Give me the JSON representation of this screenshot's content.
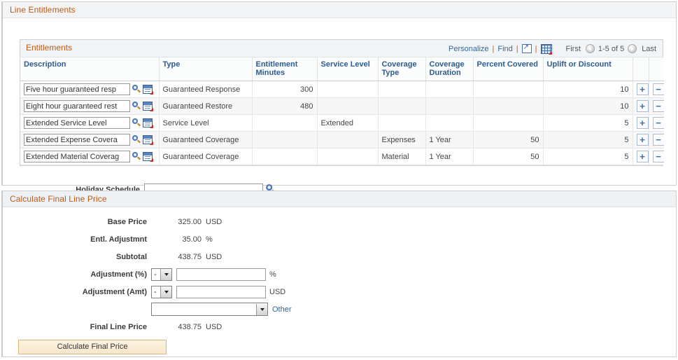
{
  "section_line_entitlements": {
    "title": "Line Entitlements"
  },
  "grid": {
    "title": "Entitlements",
    "toolbar": {
      "personalize": "Personalize",
      "find": "Find",
      "sep1": "|",
      "sep2": "|",
      "sep3": "|",
      "new_window_icon": "new-window-icon",
      "download_grid_icon": "download-to-excel-icon"
    },
    "pager": {
      "first": "First",
      "count": "1-5 of 5",
      "last": "Last",
      "prev_icon": "previous-page-icon",
      "next_icon": "next-page-icon"
    },
    "columns": [
      "Description",
      "Type",
      "Entitlement Minutes",
      "Service Level",
      "Coverage Type",
      "Coverage Duration",
      "Percent Covered",
      "Uplift or Discount",
      "",
      ""
    ],
    "rows": [
      {
        "description": "Five hour guaranteed resp",
        "type": "Guaranteed Response",
        "entitlement_minutes": "300",
        "service_level": "",
        "coverage_type": "",
        "coverage_duration": "",
        "percent_covered": "",
        "uplift_or_discount": "10",
        "add_label": "+",
        "remove_label": "−"
      },
      {
        "description": "Eight hour guaranteed rest",
        "type": "Guaranteed Restore",
        "entitlement_minutes": "480",
        "service_level": "",
        "coverage_type": "",
        "coverage_duration": "",
        "percent_covered": "",
        "uplift_or_discount": "10",
        "add_label": "+",
        "remove_label": "−"
      },
      {
        "description": "Extended Service Level",
        "type": "Service Level",
        "entitlement_minutes": "",
        "service_level": "Extended",
        "coverage_type": "",
        "coverage_duration": "",
        "percent_covered": "",
        "uplift_or_discount": "5",
        "add_label": "+",
        "remove_label": "−"
      },
      {
        "description": "Extended Expense Covera",
        "type": "Guaranteed Coverage",
        "entitlement_minutes": "",
        "service_level": "",
        "coverage_type": "Expenses",
        "coverage_duration": "1 Year",
        "percent_covered": "50",
        "uplift_or_discount": "5",
        "add_label": "+",
        "remove_label": "−"
      },
      {
        "description": "Extended Material Coverag",
        "type": "Guaranteed Coverage",
        "entitlement_minutes": "",
        "service_level": "",
        "coverage_type": "Material",
        "coverage_duration": "1 Year",
        "percent_covered": "50",
        "uplift_or_discount": "5",
        "add_label": "+",
        "remove_label": "−"
      }
    ]
  },
  "holiday_schedule": {
    "label": "Holiday Schedule",
    "value": "",
    "placeholder": "",
    "lookup_icon": "lookup-icon"
  },
  "calculate_section": {
    "title": "Calculate Final Line Price",
    "base_price": {
      "label": "Base Price",
      "value": "325.00",
      "unit": "USD"
    },
    "entl_adjustment": {
      "label": "Entl. Adjustmnt",
      "value": "35.00",
      "unit": "%"
    },
    "subtotal": {
      "label": "Subtotal",
      "value": "438.75",
      "unit": "USD"
    },
    "adjustment_pct": {
      "label": "Adjustment (%)",
      "sign": "-",
      "value": "",
      "unit": "%"
    },
    "adjustment_amt": {
      "label": "Adjustment (Amt)",
      "sign": "-",
      "value": "",
      "unit": "USD"
    },
    "other_row": {
      "selected": "",
      "link": "Other"
    },
    "final_line_price": {
      "label": "Final Line Price",
      "value": "438.75",
      "unit": "USD"
    },
    "calculate_button": "Calculate Final Price"
  },
  "colors": {
    "section_title": "#c05a16",
    "column_header": "#2d5c94",
    "link": "#336699",
    "row_button": "#3b6ea5",
    "button_bg": "#f7e7cc",
    "button_border": "#d8b679"
  }
}
